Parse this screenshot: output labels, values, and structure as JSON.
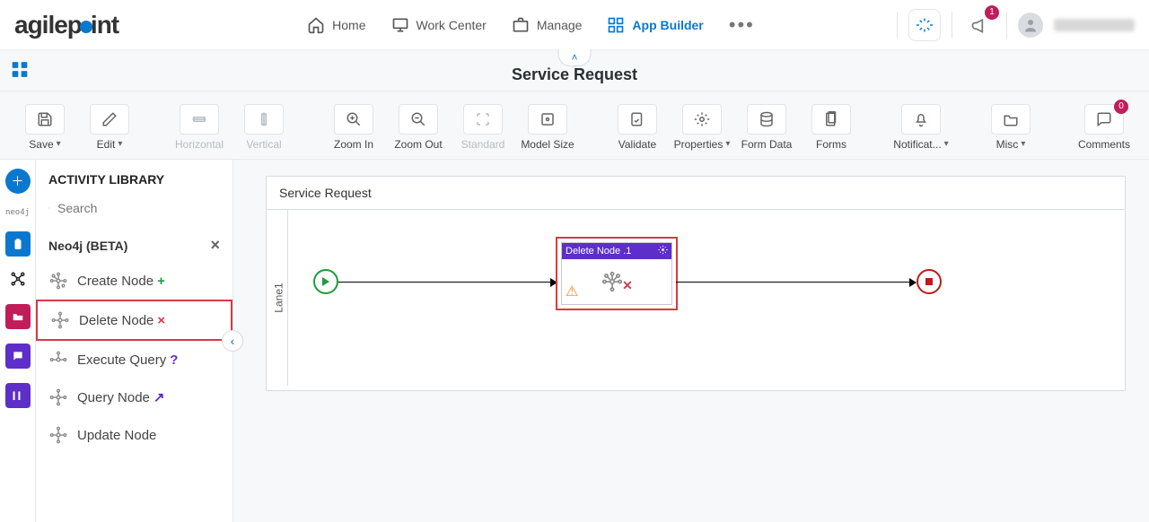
{
  "brand": "agilepoint",
  "nav": {
    "home": "Home",
    "workcenter": "Work Center",
    "manage": "Manage",
    "appbuilder": "App Builder"
  },
  "notifications_badge": "1",
  "page_title": "Service Request",
  "toolbar": {
    "save": "Save",
    "edit": "Edit",
    "horizontal": "Horizontal",
    "vertical": "Vertical",
    "zoomin": "Zoom In",
    "zoomout": "Zoom Out",
    "standard": "Standard",
    "modelsize": "Model Size",
    "validate": "Validate",
    "properties": "Properties",
    "formdata": "Form Data",
    "forms": "Forms",
    "notifications": "Notificat...",
    "misc": "Misc",
    "comments": "Comments",
    "comments_count": "0"
  },
  "library": {
    "title": "ACTIVITY LIBRARY",
    "search_placeholder": "Search",
    "group": "Neo4j (BETA)",
    "items": {
      "create": "Create Node",
      "delete": "Delete Node",
      "execq": "Execute Query",
      "queryn": "Query Node",
      "updaten": "Update Node"
    }
  },
  "leftrail": {
    "neo": "neo4j"
  },
  "canvas": {
    "title": "Service Request",
    "lane": "Lane1",
    "activity_label": "Delete Node .1"
  }
}
